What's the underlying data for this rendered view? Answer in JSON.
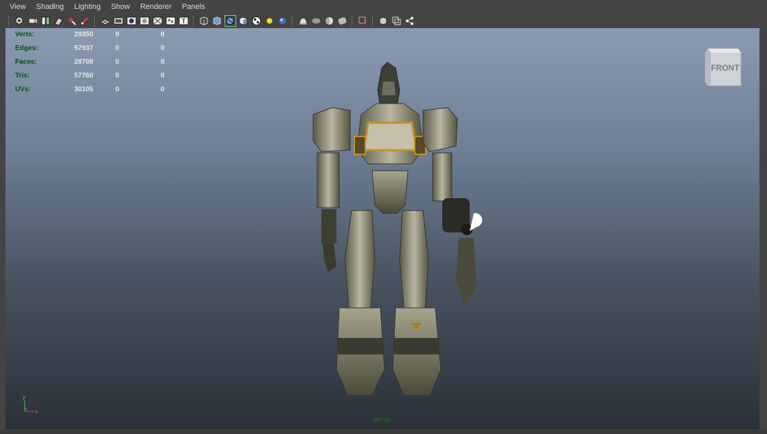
{
  "menubar": {
    "items": [
      "View",
      "Shading",
      "Lighting",
      "Show",
      "Renderer",
      "Panels"
    ]
  },
  "toolbar": {
    "icons": [
      "camera-select-icon",
      "camera-attributes-icon",
      "bookmark-icon",
      "image-plane-icon",
      "2d-pan-zoom-icon",
      "grease-pencil-icon",
      "grid-icon",
      "film-gate-icon",
      "resolution-gate-icon",
      "gate-mask-icon",
      "field-chart-icon",
      "safe-action-icon",
      "wireframe-icon",
      "smooth-shade-icon",
      "shaded-wireframe-icon",
      "default-material-icon",
      "textured-icon",
      "use-all-lights-icon",
      "shadows-icon",
      "screen-ambient-occlusion-icon",
      "motion-blur-icon",
      "multisample-aa-icon",
      "depth-of-field-icon",
      "isolate-select-icon",
      "xray-icon",
      "xray-active-components-icon",
      "xray-joints-icon"
    ]
  },
  "hud": {
    "stats": [
      {
        "label": "Verts:",
        "value": "29350",
        "c1": "0",
        "c2": "0"
      },
      {
        "label": "Edges:",
        "value": "57937",
        "c1": "0",
        "c2": "0"
      },
      {
        "label": "Faces:",
        "value": "28708",
        "c1": "0",
        "c2": "0"
      },
      {
        "label": "Tris:",
        "value": "57760",
        "c1": "0",
        "c2": "0"
      },
      {
        "label": "UVs:",
        "value": "30105",
        "c1": "0",
        "c2": "0"
      }
    ]
  },
  "viewcube": {
    "label": "FRONT"
  },
  "camera": {
    "label": "persp"
  },
  "axis": {
    "y": "y",
    "x": "x"
  },
  "colors": {
    "panel_bg": "#444444",
    "menu_text": "#dcdcdc",
    "hud_label": "#0d4f0d",
    "hud_value": "#e8e8e8",
    "viewport_top": "#8a9bb1",
    "viewport_bottom": "#2a3038"
  }
}
